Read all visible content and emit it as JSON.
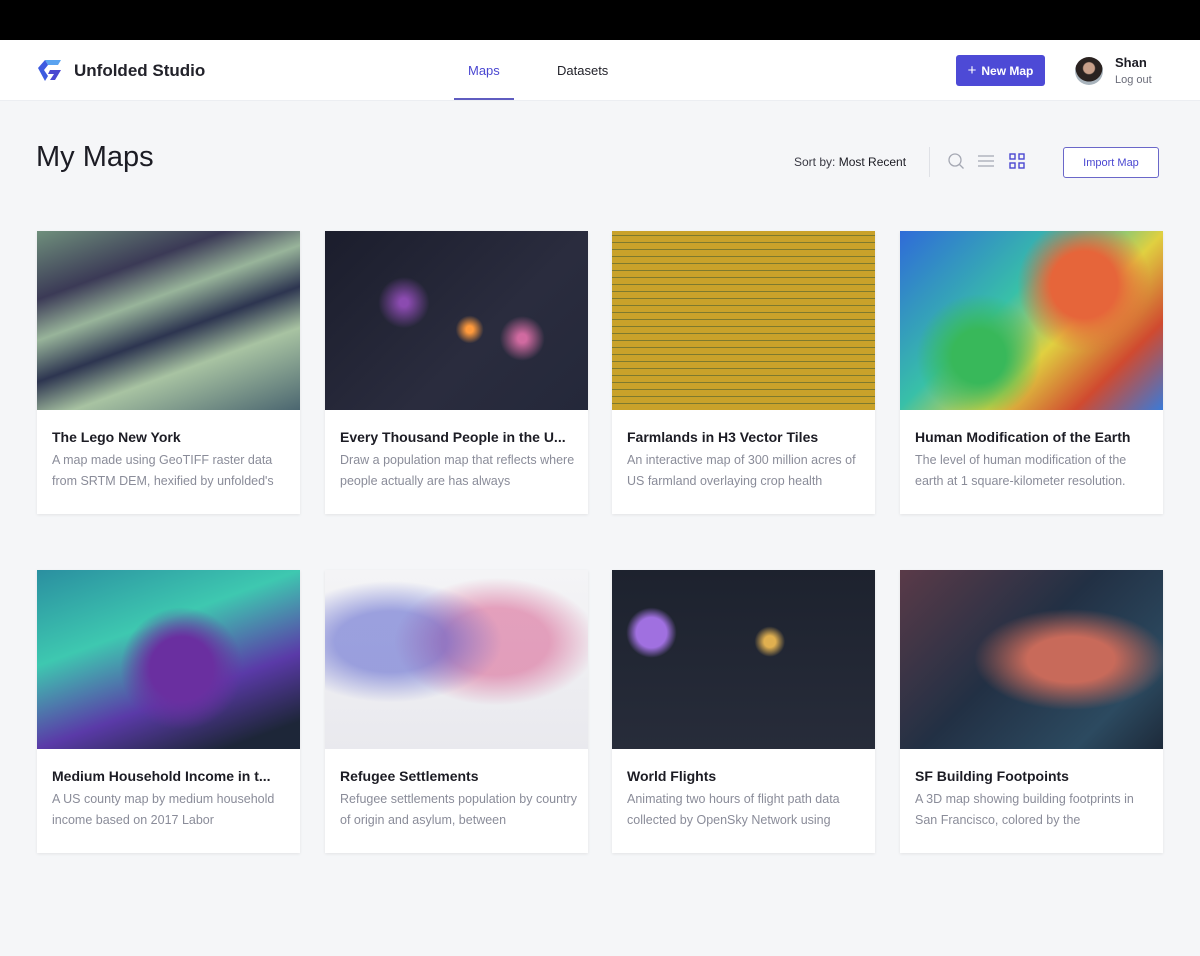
{
  "app": {
    "brand": "Unfolded Studio"
  },
  "nav": {
    "tabs": [
      {
        "label": "Maps"
      },
      {
        "label": "Datasets"
      }
    ]
  },
  "header": {
    "new_map": "New Map",
    "user_name": "Shan",
    "logout": "Log out"
  },
  "page": {
    "title": "My Maps",
    "sort_label": "Sort by:",
    "sort_value": "Most Recent",
    "import": "Import Map"
  },
  "maps": [
    {
      "title": "The Lego New York",
      "desc": "A map made using GeoTIFF raster data from SRTM DEM, hexified by unfolded's"
    },
    {
      "title": "Every Thousand People in the U...",
      "desc": "Draw a population map that reflects where people actually are has always"
    },
    {
      "title": "Farmlands in H3 Vector Tiles",
      "desc": "An interactive map of 300 million acres of US farmland overlaying crop health"
    },
    {
      "title": "Human Modification of the Earth",
      "desc": "The level of human modification of the earth at 1 square-kilometer resolution."
    },
    {
      "title": "Medium Household Income in t...",
      "desc": "A US county map by medium household income based on 2017 Labor"
    },
    {
      "title": "Refugee Settlements",
      "desc": "Refugee settlements population by country of origin and asylum, between"
    },
    {
      "title": "World Flights",
      "desc": "Animating two hours of flight path data collected by OpenSky Network using"
    },
    {
      "title": "SF Building Footpoints",
      "desc": "A 3D map showing building footprints in San Francisco, colored by the"
    }
  ]
}
